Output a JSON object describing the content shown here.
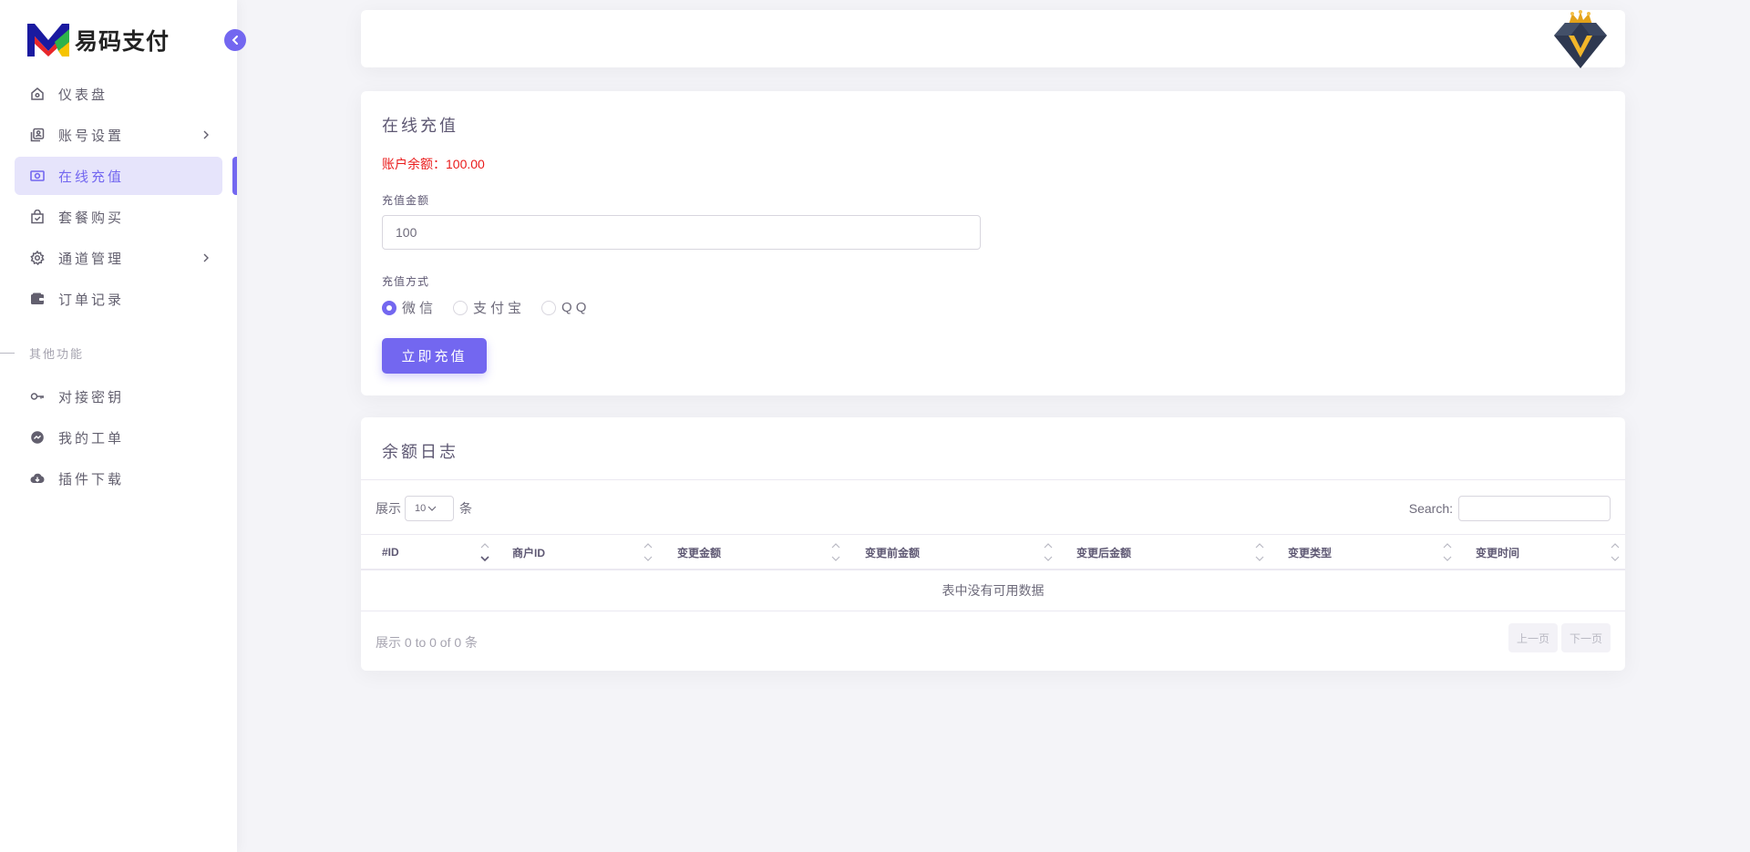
{
  "sidebar": {
    "brand": "易码支付",
    "items": [
      {
        "label": "仪表盘",
        "icon": "home-icon"
      },
      {
        "label": "账号设置",
        "icon": "user-card-icon"
      },
      {
        "label": "在线充值",
        "icon": "cash-icon"
      },
      {
        "label": "套餐购买",
        "icon": "shopping-bag-icon"
      },
      {
        "label": "通道管理",
        "icon": "gear-icon"
      },
      {
        "label": "订单记录",
        "icon": "wallet-icon"
      }
    ],
    "section_title": "其他功能",
    "items2": [
      {
        "label": "对接密钥",
        "icon": "key-icon"
      },
      {
        "label": "我的工单",
        "icon": "chat-icon"
      },
      {
        "label": "插件下载",
        "icon": "cloud-download-icon"
      }
    ]
  },
  "recharge": {
    "title": "在线充值",
    "balance": "账户余额：100.00",
    "amount_label": "充值金额",
    "amount_value": "100",
    "method_label": "充值方式",
    "methods": [
      "微信",
      "支付宝",
      "QQ"
    ],
    "selected_method": "微信",
    "submit_label": "立即充值"
  },
  "log": {
    "title": "余额日志",
    "show_prefix": "展示",
    "page_size": "10",
    "show_suffix": "条",
    "search_label": "Search:",
    "columns": [
      "#ID",
      "商户ID",
      "变更金额",
      "变更前金额",
      "变更后金额",
      "变更类型",
      "变更时间"
    ],
    "empty_text": "表中没有可用数据",
    "info": "展示 0 to 0 of 0 条",
    "prev": "上一页",
    "next": "下一页"
  },
  "colors": {
    "primary": "#7367f0",
    "danger": "#ea1b1b",
    "background": "#f4f4f8"
  }
}
